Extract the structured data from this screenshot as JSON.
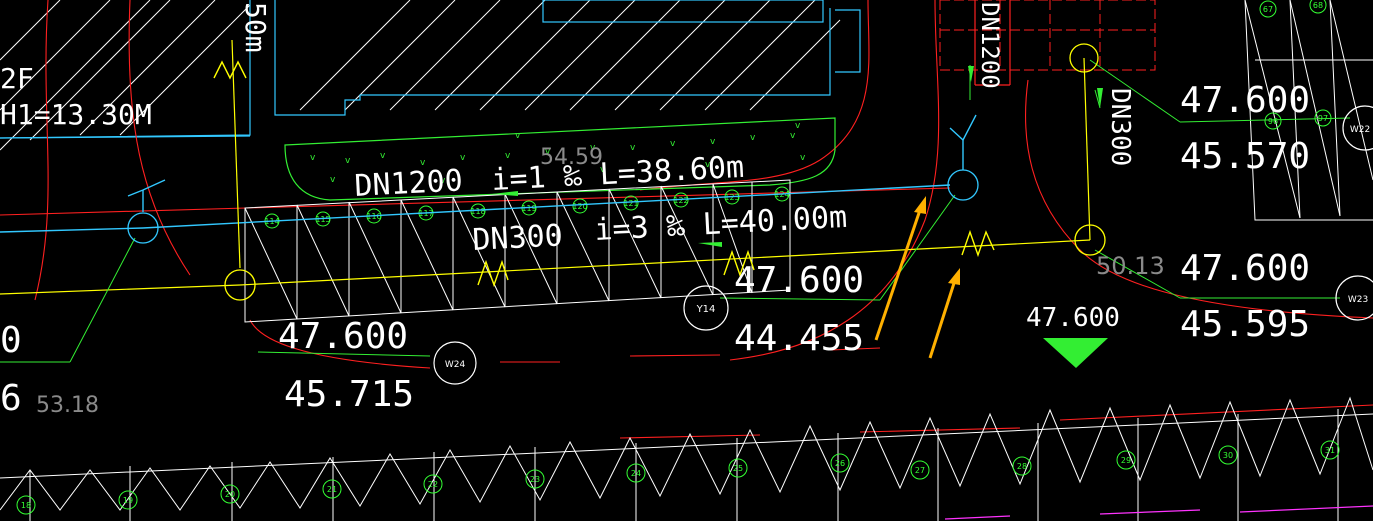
{
  "colors": {
    "background": "#000000",
    "white": "#ffffff",
    "cyan": "#32c8ff",
    "yellow": "#ffff00",
    "red": "#ff2020",
    "green": "#33ee33",
    "orange": "#ffb000"
  },
  "texts": {
    "building_floor": "2F",
    "building_height": "H1=13.30M",
    "pipe_label_1": "DN1200",
    "pipe_slope_1": "i=1 ‰ L=38.60m",
    "pipe_faint_1": "54.59",
    "pipe_label_2": "DN300",
    "pipe_slope_2": "i=3 ‰ L=40.00m",
    "vertical_left": "50m",
    "vertical_dn1200": "DN1200",
    "vertical_dn300": "DN300",
    "elev_top_right": "47.600",
    "elev_bottom_right_top": "45.570",
    "elev_mid_center_top": "47.600",
    "elev_mid_center_bottom": "44.455",
    "elev_left_top": "47.600",
    "elev_left_bottom": "45.715",
    "elev_right_mid_top": "47.600",
    "elev_right_mid_bottom": "45.595",
    "elev_marker": "47.600",
    "faint_right": "50.13",
    "faint_left": "53.18",
    "edge_digit_1": "0",
    "edge_digit_2": "6",
    "well_y14": "Y14",
    "well_w24": "W24",
    "well_w23": "W23",
    "well_w22": "W22",
    "marker_w": "W"
  },
  "parking_upper": [
    "114",
    "115",
    "116",
    "117",
    "118",
    "119",
    "120",
    "121",
    "122",
    "123",
    "124"
  ],
  "parking_bottom": [
    "18",
    "19",
    "20",
    "21",
    "22",
    "23",
    "24",
    "25",
    "26",
    "27",
    "28",
    "29",
    "30",
    "31"
  ],
  "parking_top_right": [
    "67",
    "68",
    "96",
    "97"
  ]
}
